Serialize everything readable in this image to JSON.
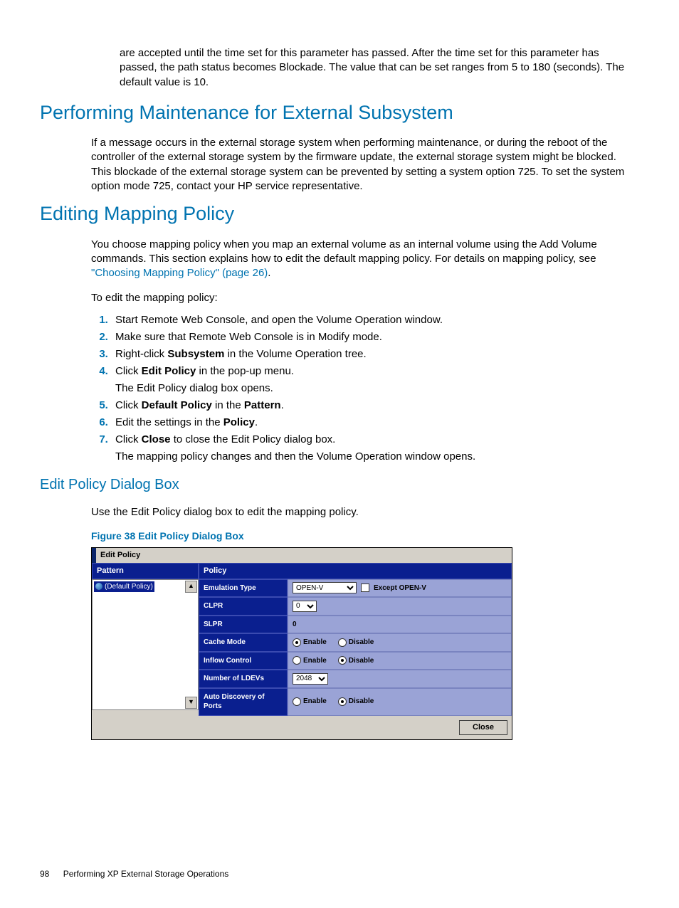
{
  "intro": {
    "text": "are accepted until the time set for this parameter has passed. After the time set for this parameter has passed, the path status becomes Blockade. The value that can be set ranges from 5 to 180 (seconds). The default value is 10."
  },
  "section1": {
    "title": "Performing Maintenance for External Subsystem",
    "para_pre": "If a ",
    "para_post": " message occurs in the external storage system when performing maintenance, or during the reboot of the controller of the external storage system by the firmware update, the external storage system might be blocked. This blockade of the external storage system can be prevented by setting a system option 725. To set the system option mode 725, contact your HP service representative."
  },
  "section2": {
    "title": "Editing Mapping Policy",
    "para1_a": "You choose mapping policy when you map an external volume as an internal volume using the Add Volume commands. This section explains how to edit the default mapping policy. For details on mapping policy, see ",
    "link": "\"Choosing Mapping Policy\" (page 26)",
    "para1_b": ".",
    "para2": "To edit the mapping policy:",
    "steps": {
      "s1": "Start Remote Web Console, and open the Volume Operation window.",
      "s2": "Make sure that Remote Web Console is in Modify mode.",
      "s3a": "Right-click ",
      "s3b": "Subsystem",
      "s3c": " in the Volume Operation tree.",
      "s4a": "Click ",
      "s4b": "Edit Policy",
      "s4c": " in the pop-up menu.",
      "s4sub": "The Edit Policy dialog box opens.",
      "s5a": "Click ",
      "s5b": "Default Policy",
      "s5c": " in the ",
      "s5d": "Pattern",
      "s5e": ".",
      "s6a": "Edit the settings in the ",
      "s6b": "Policy",
      "s6c": ".",
      "s7a": "Click ",
      "s7b": "Close",
      "s7c": " to close the Edit Policy dialog box.",
      "s7sub": "The mapping policy changes and then the Volume Operation window opens."
    }
  },
  "section3": {
    "title": "Edit Policy Dialog Box",
    "para": "Use the Edit Policy dialog box to edit the mapping policy.",
    "figure_caption": "Figure 38 Edit Policy Dialog Box"
  },
  "dialog": {
    "title": "Edit Policy",
    "pattern_header": "Pattern",
    "policy_header": "Policy",
    "pattern_item": "(Default Policy)",
    "rows": {
      "emulation": {
        "label": "Emulation Type",
        "value": "OPEN-V",
        "cb_label": "Except OPEN-V"
      },
      "clpr": {
        "label": "CLPR",
        "value": "0"
      },
      "slpr": {
        "label": "SLPR",
        "value": "0"
      },
      "cache": {
        "label": "Cache Mode",
        "enable": "Enable",
        "disable": "Disable",
        "selected": "enable"
      },
      "inflow": {
        "label": "Inflow Control",
        "enable": "Enable",
        "disable": "Disable",
        "selected": "disable"
      },
      "ldevs": {
        "label": "Number of LDEVs",
        "value": "2048"
      },
      "autodisc": {
        "label": "Auto Discovery of Ports",
        "enable": "Enable",
        "disable": "Disable",
        "selected": "disable"
      }
    },
    "close": "Close"
  },
  "footer": {
    "page": "98",
    "chapter": "Performing XP External Storage Operations"
  }
}
